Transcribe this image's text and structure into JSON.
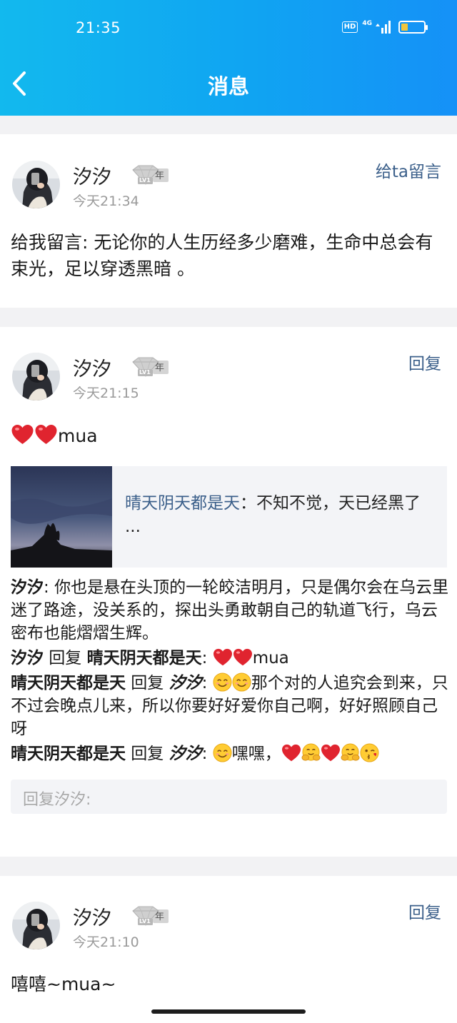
{
  "status_bar": {
    "time": "21:35",
    "hd": "HD",
    "network": "4G"
  },
  "header": {
    "title": "消息"
  },
  "messages": [
    {
      "username": "汐汐",
      "badge_text": "年",
      "badge_level": "LV1",
      "time": "今天21:34",
      "action": "给ta留言",
      "text": "给我留言: 无论你的人生历经多少磨难，生命中总会有束光，足以穿透黑暗 。"
    },
    {
      "username": "汐汐",
      "badge_text": "年",
      "badge_level": "LV1",
      "time": "今天21:15",
      "action": "回复",
      "text": "mua",
      "quote": {
        "author": "晴天阴天都是天",
        "sep": "：",
        "text": "不知不觉，天已经黑了 ..."
      },
      "replies": [
        {
          "from": "汐汐",
          "colon": ": ",
          "text": "你也是悬在头顶的一轮皎洁明月，只是偶尔会在乌云里迷了路途，没关系的，探出头勇敢朝自己的轨道飞行，乌云密布也能熠熠生辉。"
        },
        {
          "from": "汐汐",
          "verb": " 回复 ",
          "to": "晴天阴天都是天",
          "colon": ": ",
          "text": "mua"
        },
        {
          "from": "晴天阴天都是天",
          "verb": " 回复 ",
          "to": "汐汐",
          "colon": ": ",
          "text": "那个对的人追究会到来，只不过会晚点儿来，所以你要好好爱你自己啊，好好照顾自己呀"
        },
        {
          "from": "晴天阴天都是天",
          "verb": " 回复 ",
          "to": "汐汐",
          "colon": ": ",
          "text": "嘿嘿，"
        }
      ],
      "reply_placeholder": "回复汐汐:"
    },
    {
      "username": "汐汐",
      "badge_text": "年",
      "badge_level": "LV1",
      "time": "今天21:10",
      "action": "回复",
      "text": "嘻嘻~mua~"
    }
  ],
  "colors": {
    "header_start": "#12b9ee",
    "header_end": "#1591f7",
    "link": "#3b5f8a",
    "heart": "#e0242f"
  }
}
